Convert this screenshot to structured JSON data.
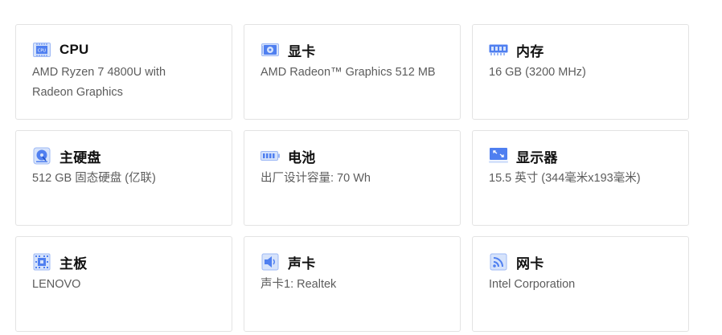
{
  "cards": [
    {
      "icon": "cpu-icon",
      "title": "CPU",
      "desc": "AMD Ryzen 7 4800U with Radeon Graphics"
    },
    {
      "icon": "graphics-card-icon",
      "title": "显卡",
      "desc": "AMD Radeon™ Graphics 512 MB"
    },
    {
      "icon": "memory-icon",
      "title": "内存",
      "desc": "16 GB (3200 MHz)"
    },
    {
      "icon": "hard-disk-icon",
      "title": "主硬盘",
      "desc": "512 GB 固态硬盘 (亿联)"
    },
    {
      "icon": "battery-icon",
      "title": "电池",
      "desc": "出厂设计容量: 70 Wh"
    },
    {
      "icon": "monitor-icon",
      "title": "显示器",
      "desc": "15.5 英寸 (344毫米x193毫米)"
    },
    {
      "icon": "motherboard-icon",
      "title": "主板",
      "desc": "LENOVO"
    },
    {
      "icon": "sound-card-icon",
      "title": "声卡",
      "desc": "声卡1: Realtek"
    },
    {
      "icon": "network-card-icon",
      "title": "网卡",
      "desc": "Intel Corporation"
    }
  ],
  "colors": {
    "icon_blue": "#4f7ff0",
    "icon_light": "#d6e3fb",
    "title": "#111111",
    "desc": "#5c5c5c",
    "border": "#e3e3e3"
  }
}
